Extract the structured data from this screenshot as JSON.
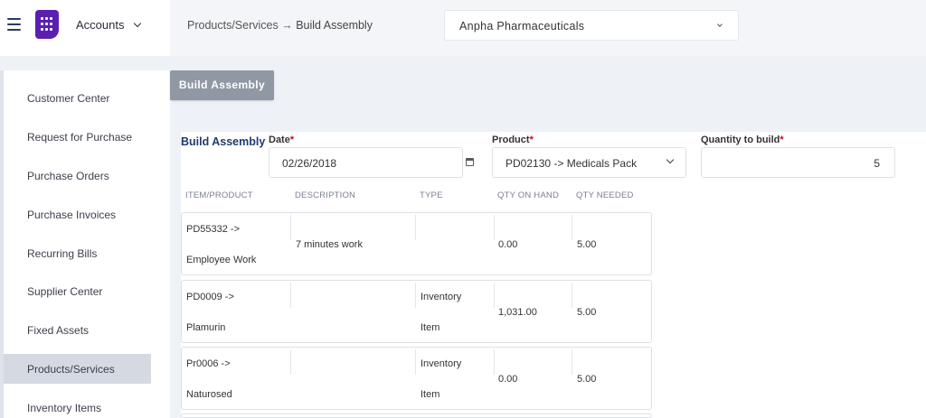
{
  "header": {
    "app_name": "Accounts",
    "breadcrumb_parent": "Products/Services",
    "breadcrumb_separator": "→",
    "breadcrumb_current": "Build Assembly",
    "company": "Anpha Pharmaceuticals",
    "icons": {
      "menu": "hamburger-icon",
      "logo": "app-grid-icon",
      "dropdown": "chevron-down-icon"
    }
  },
  "sidebar": {
    "items": [
      {
        "label": "Customer Center"
      },
      {
        "label": "Request for Purchase"
      },
      {
        "label": "Purchase Orders"
      },
      {
        "label": "Purchase Invoices"
      },
      {
        "label": "Recurring Bills"
      },
      {
        "label": "Supplier Center"
      },
      {
        "label": "Fixed Assets"
      },
      {
        "label": "Products/Services",
        "active": true
      },
      {
        "label": "Inventory Items"
      }
    ]
  },
  "page": {
    "title_button": "Build Assembly",
    "form_title": "Build Assembly"
  },
  "form": {
    "date_label": "Date",
    "date_value": "02/26/2018",
    "product_label": "Product",
    "product_value": "PD02130 -> Medicals Pack",
    "qty_label": "Quantity to build",
    "qty_value": "5",
    "required_marker": "*"
  },
  "table": {
    "headers": [
      "ITEM/PRODUCT",
      "DESCRIPTION",
      "TYPE",
      "QTY ON HAND",
      "QTY NEEDED"
    ],
    "rows": [
      {
        "item_code": "PD55332 ->",
        "item_name": "Employee Work",
        "description": "7 minutes work",
        "type_line1": "",
        "type_line2": "",
        "qty_on_hand": "0.00",
        "qty_needed": "5.00"
      },
      {
        "item_code": "PD0009 ->",
        "item_name": "Plamurin",
        "description": "",
        "type_line1": "Inventory",
        "type_line2": "Item",
        "qty_on_hand": "1,031.00",
        "qty_needed": "5.00"
      },
      {
        "item_code": "Pr0006 ->",
        "item_name": "Naturosed",
        "description": "",
        "type_line1": "Inventory",
        "type_line2": "Item",
        "qty_on_hand": "0.00",
        "qty_needed": "5.00"
      }
    ]
  },
  "colors": {
    "brand_purple": "#5b1fb0",
    "form_title": "#1f3b70",
    "required": "#d0021b",
    "title_button": "#9098a3",
    "sidebar_active": "#d5d9e1"
  }
}
